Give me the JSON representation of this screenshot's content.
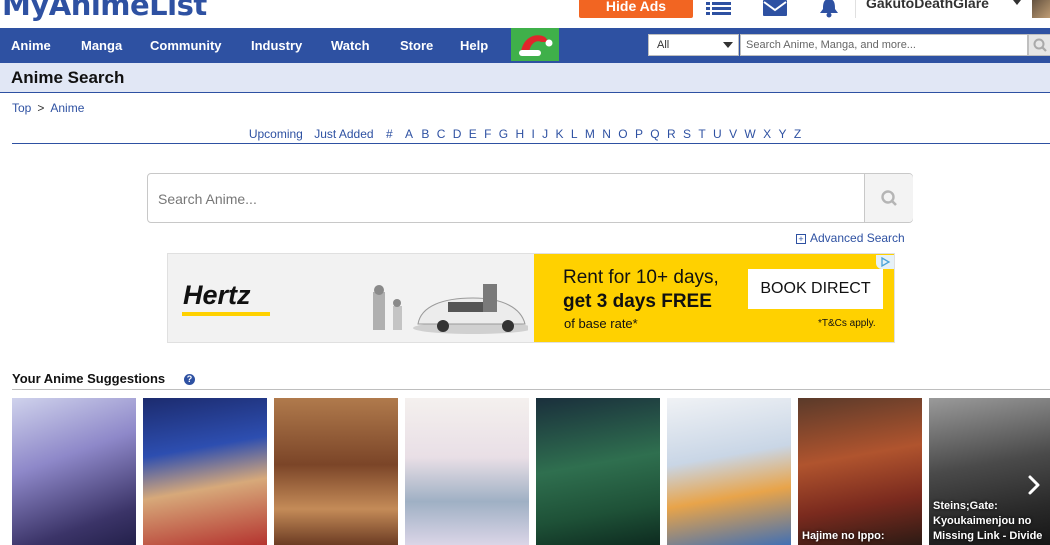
{
  "header": {
    "logo": "MyAnimeList",
    "hide_ads": "Hide Ads",
    "username": "GakutoDeathGlare",
    "icons": [
      "list-icon",
      "mail-icon",
      "bell-icon"
    ]
  },
  "nav": {
    "items": [
      "Anime",
      "Manga",
      "Community",
      "Industry",
      "Watch",
      "Store",
      "Help"
    ],
    "search_select": "All",
    "search_placeholder": "Search Anime, Manga, and more..."
  },
  "page": {
    "title": "Anime Search",
    "breadcrumb": [
      "Top",
      ">",
      "Anime"
    ],
    "filters": [
      "Upcoming",
      "Just Added",
      "#",
      "A",
      "B",
      "C",
      "D",
      "E",
      "F",
      "G",
      "H",
      "I",
      "J",
      "K",
      "L",
      "M",
      "N",
      "O",
      "P",
      "Q",
      "R",
      "S",
      "T",
      "U",
      "V",
      "W",
      "X",
      "Y",
      "Z"
    ],
    "search_placeholder": "Search Anime...",
    "advanced_search": "Advanced Search"
  },
  "ad": {
    "brand": "Hertz",
    "line1": "Rent for 10+ days,",
    "line2": "get 3 days FREE",
    "line3": "of base rate*",
    "cta": "BOOK DIRECT",
    "terms": "*T&Cs apply."
  },
  "suggestions": {
    "title": "Your Anime Suggestions",
    "help": "?",
    "captions": [
      "",
      "",
      "",
      "",
      "",
      "",
      "Hajime no Ippo:",
      "Steins;Gate: Kyoukaimenjou no Missing Link - Divide"
    ]
  },
  "colors": {
    "brand_blue": "#2e51a2",
    "hide_ads_orange": "#f26522",
    "heading_bg": "#e1e7f5",
    "ad_yellow": "#ffd100"
  }
}
